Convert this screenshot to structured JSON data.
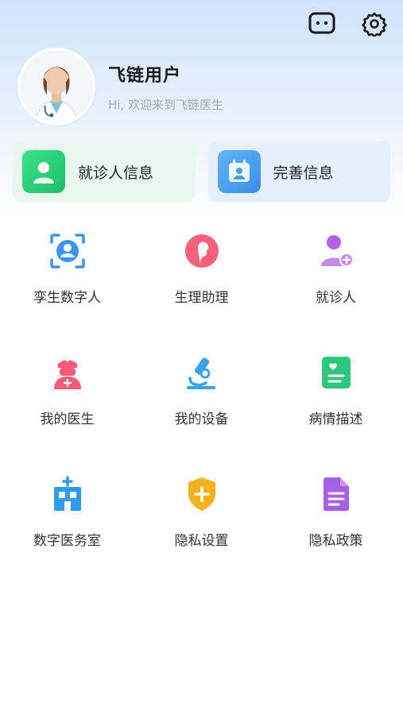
{
  "header": {
    "message_icon": "message-icon",
    "settings_icon": "gear-icon"
  },
  "profile": {
    "name": "飞链用户",
    "greeting": "Hi, 欢迎来到飞链医生",
    "avatar_icon": "doctor-avatar"
  },
  "cards": [
    {
      "label": "就诊人信息",
      "icon": "patient-card-icon",
      "color": "#2ed47a"
    },
    {
      "label": "完善信息",
      "icon": "calendar-profile-icon",
      "color": "#4aa3f0"
    }
  ],
  "grid": [
    {
      "label": "孪生数字人",
      "icon": "face-scan-icon",
      "color": "#3b95f0"
    },
    {
      "label": "生理助理",
      "icon": "female-silhouette-icon",
      "color": "#f5607a"
    },
    {
      "label": "就诊人",
      "icon": "add-user-icon",
      "color": "#b162e8"
    },
    {
      "label": "我的医生",
      "icon": "nurse-icon",
      "color": "#f55a77"
    },
    {
      "label": "我的设备",
      "icon": "microscope-icon",
      "color": "#35a4f0"
    },
    {
      "label": "病情描述",
      "icon": "health-record-icon",
      "color": "#2cc77a"
    },
    {
      "label": "数字医务室",
      "icon": "hospital-icon",
      "color": "#2f9cf0"
    },
    {
      "label": "隐私设置",
      "icon": "shield-plus-icon",
      "color": "#f5b21c"
    },
    {
      "label": "隐私政策",
      "icon": "document-icon",
      "color": "#a65fe6"
    }
  ]
}
